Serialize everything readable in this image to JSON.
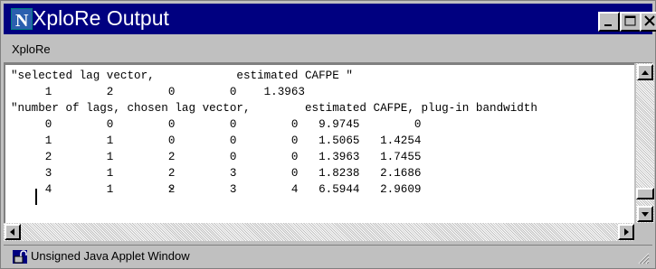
{
  "window": {
    "title": "XploRe Output",
    "logo_letter": "N"
  },
  "menu": {
    "items": [
      "XploRe"
    ]
  },
  "output": {
    "lines": [
      "\"selected lag vector,            estimated CAFPE \"",
      "     1        2        0        0    1.3963",
      "\"number of lags, chosen lag vector,        estimated CAFPE, plug-in bandwidth",
      "     0        0        0        0        0   9.9745        0",
      "     1        1        0        0        0   1.5065   1.4254",
      "     2        1        2        0        0   1.3963   1.7455",
      "     3        1        2        3        0   1.8238   2.1686",
      "     4        1        2        3        4   6.5944   2.9609"
    ]
  },
  "statusbar": {
    "text": "Unsigned Java Applet Window"
  }
}
